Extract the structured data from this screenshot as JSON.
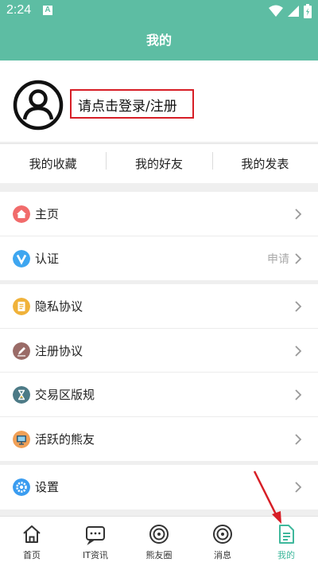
{
  "status_bar": {
    "time": "2:24",
    "notification_badge": "A"
  },
  "title_bar": {
    "title": "我的"
  },
  "profile": {
    "login_prompt": "请点击登录/注册"
  },
  "tabs": [
    {
      "label": "我的收藏"
    },
    {
      "label": "我的好友"
    },
    {
      "label": "我的发表"
    }
  ],
  "menu_group_1": [
    {
      "label": "主页",
      "value": "",
      "icon": "home-icon",
      "color": "#f16b6b"
    },
    {
      "label": "认证",
      "value": "申请",
      "icon": "verify-icon",
      "color": "#3ea6f0"
    }
  ],
  "menu_group_2": [
    {
      "label": "隐私协议",
      "icon": "privacy-icon",
      "color": "#f0b23a"
    },
    {
      "label": "注册协议",
      "icon": "register-icon",
      "color": "#9a6b67"
    },
    {
      "label": "交易区版规",
      "icon": "rules-icon",
      "color": "#4c7a86"
    },
    {
      "label": "活跃的熊友",
      "icon": "active-users-icon",
      "color": "#f0a057"
    }
  ],
  "menu_group_3": [
    {
      "label": "设置",
      "icon": "settings-icon",
      "color": "#3a9cf0"
    }
  ],
  "bottom_nav": [
    {
      "label": "首页",
      "icon": "home-nav-icon"
    },
    {
      "label": "IT资讯",
      "icon": "news-nav-icon"
    },
    {
      "label": "熊友圈",
      "icon": "circle-nav-icon"
    },
    {
      "label": "消息",
      "icon": "message-nav-icon"
    },
    {
      "label": "我的",
      "icon": "mine-nav-icon"
    }
  ],
  "colors": {
    "brand": "#5dbda3",
    "active_tab": "#3fb89c",
    "annotation": "#d71e26"
  }
}
